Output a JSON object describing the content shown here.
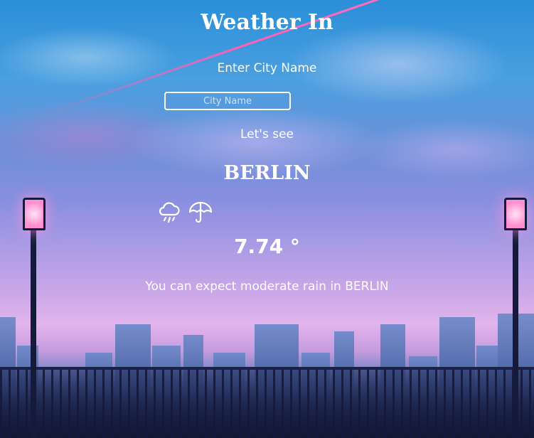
{
  "app": {
    "title": "Weather In",
    "prompt": "Enter City Name",
    "input": {
      "value": "",
      "placeholder": "City Name"
    },
    "submit_label": "Let's see"
  },
  "result": {
    "city": "BERLIN",
    "icons": [
      "cloud-rain-icon",
      "umbrella-icon"
    ],
    "temperature": "7.74 °",
    "description": "You can expect moderate rain in BERLIN"
  },
  "colors": {
    "text": "#ffffff",
    "accent_streak": "#ff5fb4",
    "sky_top": "#2a8ed8",
    "sky_bottom": "#161c3c"
  }
}
